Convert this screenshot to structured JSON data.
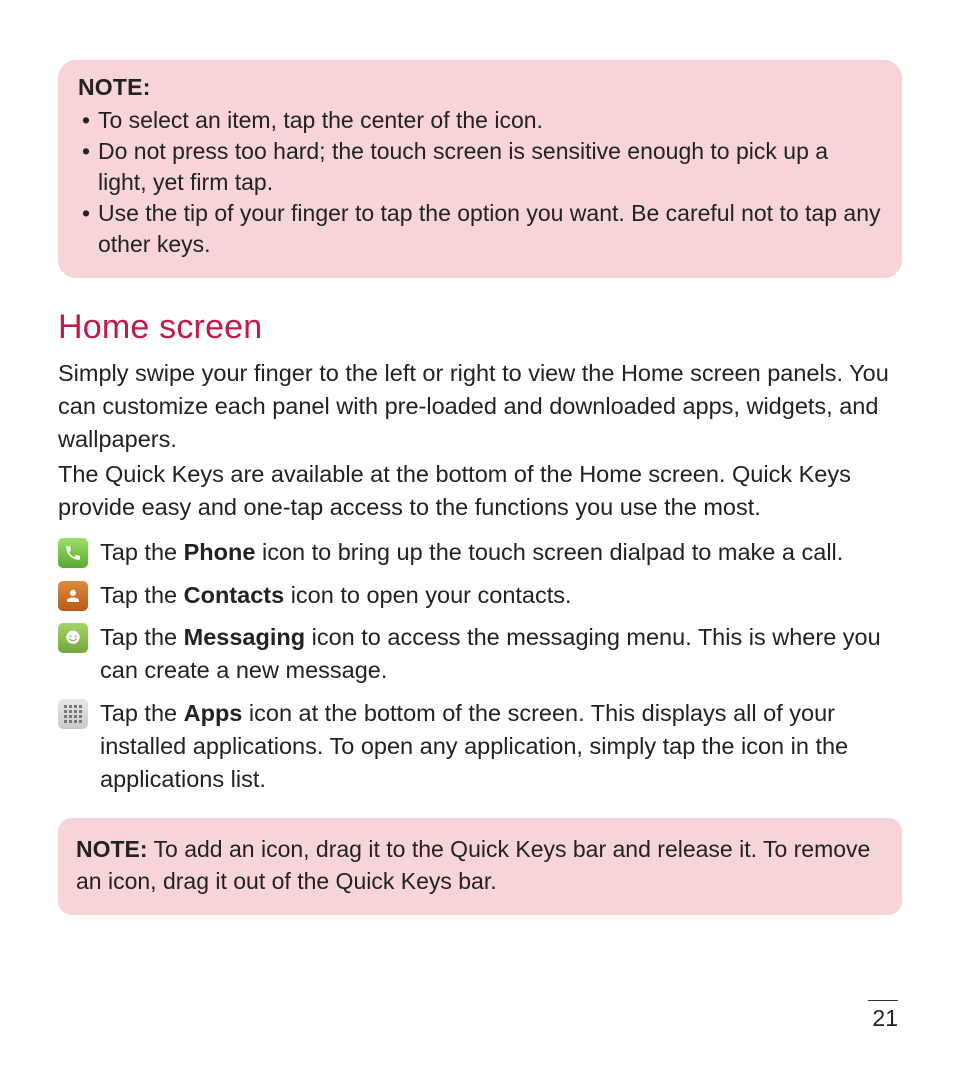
{
  "note1": {
    "title": "NOTE:",
    "items": [
      "To select an item, tap the center of the icon.",
      "Do not press too hard; the touch screen is sensitive enough to pick up a light, yet firm tap.",
      "Use the tip of your finger to tap the option you want. Be careful not to tap any other keys."
    ]
  },
  "heading": "Home screen",
  "para1": "Simply swipe your finger to the left or right to view the Home screen panels. You can customize each panel with pre-loaded and downloaded apps, widgets, and wallpapers.",
  "para2": "The Quick Keys are available at the bottom of the Home screen. Quick Keys provide easy and one-tap access to the functions you use the most.",
  "quick": [
    {
      "bold": "Phone",
      "pre": "Tap the ",
      "post": " icon to bring up the touch screen dialpad to make a call."
    },
    {
      "bold": "Contacts",
      "pre": "Tap the ",
      "post": " icon to open your contacts."
    },
    {
      "bold": "Messaging",
      "pre": "Tap the ",
      "post": " icon to access the messaging menu. This is where you can create a new message."
    },
    {
      "bold": "Apps",
      "pre": "Tap the ",
      "post": " icon at the bottom of the screen. This displays all of your installed applications. To open any application, simply tap the icon in the applications list."
    }
  ],
  "note2": {
    "label": "NOTE:",
    "text": " To add an icon, drag it to the Quick Keys bar and release it. To remove an icon, drag it out of the Quick Keys bar."
  },
  "pageNumber": "21"
}
